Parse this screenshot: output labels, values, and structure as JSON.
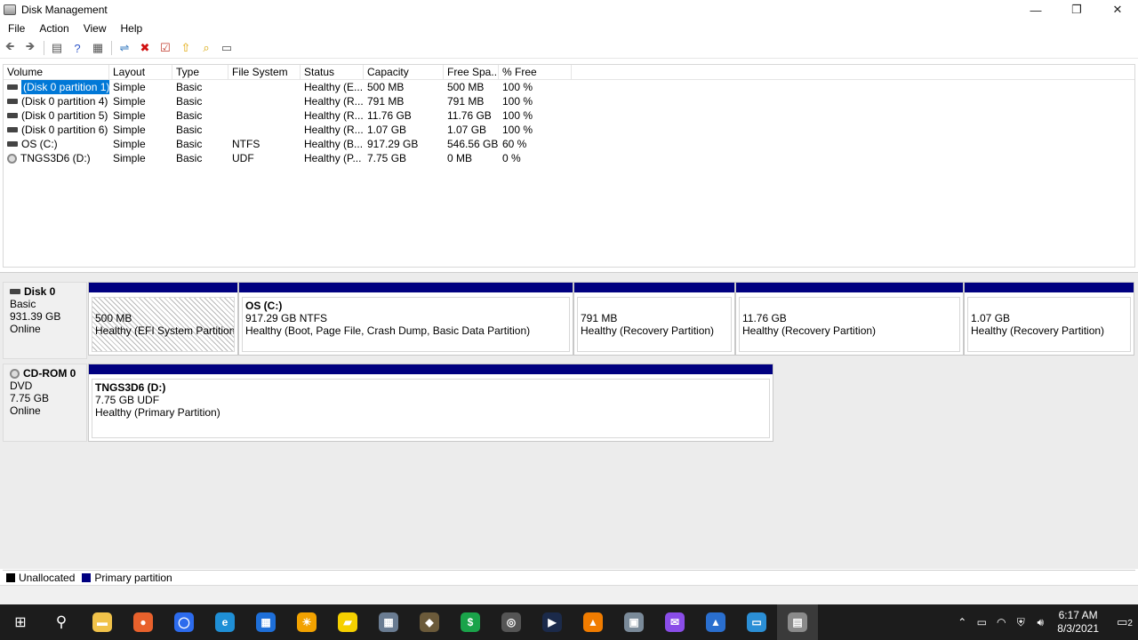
{
  "window": {
    "title": "Disk Management"
  },
  "menu": [
    "File",
    "Action",
    "View",
    "Help"
  ],
  "toolbar": [
    {
      "name": "back-icon",
      "glyph": "🡸",
      "color": "#6a6a6a"
    },
    {
      "name": "forward-icon",
      "glyph": "🡺",
      "color": "#6a6a6a"
    },
    {
      "name": "show-hide-console-tree-icon",
      "glyph": "▤",
      "color": "#555"
    },
    {
      "name": "help-icon",
      "glyph": "?",
      "color": "#2f56c8"
    },
    {
      "name": "properties-icon",
      "glyph": "▦",
      "color": "#555"
    },
    {
      "name": "connect-icon",
      "glyph": "⇌",
      "color": "#3a7cc0"
    },
    {
      "name": "delete-icon",
      "glyph": "✖",
      "color": "#d01010"
    },
    {
      "name": "check-icon",
      "glyph": "☑",
      "color": "#c0392b"
    },
    {
      "name": "import-icon",
      "glyph": "⇧",
      "color": "#e0a500"
    },
    {
      "name": "search-icon",
      "glyph": "⌕",
      "color": "#d6a400"
    },
    {
      "name": "view-icon",
      "glyph": "▭",
      "color": "#555"
    }
  ],
  "columns": [
    "Volume",
    "Layout",
    "Type",
    "File System",
    "Status",
    "Capacity",
    "Free Spa...",
    "% Free"
  ],
  "volumes": [
    {
      "volume": "(Disk 0 partition 1)",
      "layout": "Simple",
      "type": "Basic",
      "fs": "",
      "status": "Healthy (E...",
      "capacity": "500 MB",
      "free": "500 MB",
      "pct": "100 %"
    },
    {
      "volume": "(Disk 0 partition 4)",
      "layout": "Simple",
      "type": "Basic",
      "fs": "",
      "status": "Healthy (R...",
      "capacity": "791 MB",
      "free": "791 MB",
      "pct": "100 %"
    },
    {
      "volume": "(Disk 0 partition 5)",
      "layout": "Simple",
      "type": "Basic",
      "fs": "",
      "status": "Healthy (R...",
      "capacity": "11.76 GB",
      "free": "11.76 GB",
      "pct": "100 %"
    },
    {
      "volume": "(Disk 0 partition 6)",
      "layout": "Simple",
      "type": "Basic",
      "fs": "",
      "status": "Healthy (R...",
      "capacity": "1.07 GB",
      "free": "1.07 GB",
      "pct": "100 %"
    },
    {
      "volume": "OS (C:)",
      "layout": "Simple",
      "type": "Basic",
      "fs": "NTFS",
      "status": "Healthy (B...",
      "capacity": "917.29 GB",
      "free": "546.56 GB",
      "pct": "60 %"
    },
    {
      "volume": "TNGS3D6 (D:)",
      "layout": "Simple",
      "type": "Basic",
      "fs": "UDF",
      "status": "Healthy (P...",
      "capacity": "7.75 GB",
      "free": "0 MB",
      "pct": "0 %"
    }
  ],
  "disk0": {
    "name": "Disk 0",
    "kind": "Basic",
    "size": "931.39 GB",
    "state": "Online",
    "partitions": [
      {
        "title": "",
        "size": "500 MB",
        "status": "Healthy (EFI System Partition)"
      },
      {
        "title": "OS  (C:)",
        "size": "917.29 GB NTFS",
        "status": "Healthy (Boot, Page File, Crash Dump, Basic Data Partition)"
      },
      {
        "title": "",
        "size": "791 MB",
        "status": "Healthy (Recovery Partition)"
      },
      {
        "title": "",
        "size": "11.76 GB",
        "status": "Healthy (Recovery Partition)"
      },
      {
        "title": "",
        "size": "1.07 GB",
        "status": "Healthy (Recovery Partition)"
      }
    ]
  },
  "cdrom0": {
    "name": "CD-ROM 0",
    "kind": "DVD",
    "size": "7.75 GB",
    "state": "Online",
    "partition": {
      "title": "TNGS3D6  (D:)",
      "size": "7.75 GB UDF",
      "status": "Healthy (Primary Partition)"
    }
  },
  "legend": {
    "unallocated": "Unallocated",
    "primary": "Primary partition",
    "unallocated_color": "#000000",
    "primary_color": "#000080"
  },
  "taskbar": {
    "apps": [
      {
        "name": "file-explorer-icon",
        "glyph": "▬",
        "color": "#f0c24a",
        "active": false
      },
      {
        "name": "firefox-icon",
        "glyph": "●",
        "color": "#e8612c",
        "active": false
      },
      {
        "name": "signal-icon",
        "glyph": "◯",
        "color": "#2c6bed",
        "active": false
      },
      {
        "name": "edge-icon",
        "glyph": "e",
        "color": "#1f8fd6",
        "active": false
      },
      {
        "name": "calendar-icon",
        "glyph": "▦",
        "color": "#1e6fd9",
        "active": false
      },
      {
        "name": "weather-icon",
        "glyph": "☀",
        "color": "#f2a200",
        "active": false
      },
      {
        "name": "sticky-notes-icon",
        "glyph": "▰",
        "color": "#f5d000",
        "active": false
      },
      {
        "name": "calculator-icon",
        "glyph": "▦",
        "color": "#6a7c92",
        "active": false
      },
      {
        "name": "gimp-icon",
        "glyph": "◆",
        "color": "#6b5a3a",
        "active": false
      },
      {
        "name": "money-icon",
        "glyph": "$",
        "color": "#1aa34a",
        "active": false
      },
      {
        "name": "media-tool-icon",
        "glyph": "◎",
        "color": "#555555",
        "active": false
      },
      {
        "name": "video-player-icon",
        "glyph": "▶",
        "color": "#1b2a4a",
        "active": false
      },
      {
        "name": "vlc-icon",
        "glyph": "▲",
        "color": "#f07c00",
        "active": false
      },
      {
        "name": "network-tool-icon",
        "glyph": "▣",
        "color": "#7a8a99",
        "active": false
      },
      {
        "name": "messenger-icon",
        "glyph": "✉",
        "color": "#8a4de8",
        "active": false
      },
      {
        "name": "photos-icon",
        "glyph": "▲",
        "color": "#2a6fcf",
        "active": false
      },
      {
        "name": "remote-desktop-icon",
        "glyph": "▭",
        "color": "#2b8fd6",
        "active": false
      },
      {
        "name": "disk-management-icon",
        "glyph": "▤",
        "color": "#8b8b8b",
        "active": true
      }
    ],
    "time": "6:17 AM",
    "date": "8/3/2021",
    "notifications": "2"
  }
}
